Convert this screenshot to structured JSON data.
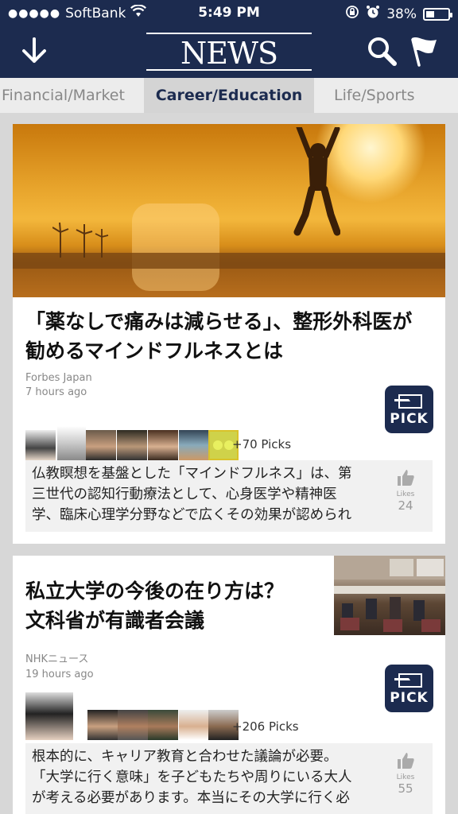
{
  "status": {
    "carrier": "SoftBank",
    "time": "5:49 PM",
    "battery": "38%"
  },
  "header": {
    "logo": "NEWS PICKS",
    "icons": [
      "download-arrow-icon",
      "search-icon",
      "flag-icon"
    ]
  },
  "tabs": [
    {
      "label": "Financial/Market",
      "active": false
    },
    {
      "label": "Career/Education",
      "active": true
    },
    {
      "label": "Life/Sports",
      "active": false
    }
  ],
  "articles": [
    {
      "title_line1": "「薬なしで痛みは減らせる」、整形外科医が",
      "title_line2": "勧めるマインドフルネスとは",
      "source": "Forbes Japan",
      "time": "7 hours ago",
      "pick_label": "PICK",
      "picks": "+70 Picks",
      "comment_line1": "仏教瞑想を基盤とした「マインドフルネス」は、第",
      "comment_line2": "三世代の認知行動療法として、心身医学や精神医",
      "comment_line3": "学、臨床心理学分野などで広くその効果が認められ",
      "likes_label": "Likes",
      "likes": "24"
    },
    {
      "title_line1": "私立大学の今後の在り方は？",
      "title_line2": "文科省が有識者会議",
      "source": "NHKニュース",
      "time": "19 hours ago",
      "pick_label": "PICK",
      "picks": "+206 Picks",
      "comment_line1": "根本的に、キャリア教育と合わせた議論が必要。",
      "comment_line2": "「大学に行く意味」を子どもたちや周りにいる大人",
      "comment_line3": "が考える必要があります。本当にその大学に行く必",
      "likes_label": "Likes",
      "likes": "55"
    }
  ],
  "colors": {
    "navy": "#1c2b4f",
    "tab_bg": "#ececec",
    "tab_active_bg": "#d4d4d4",
    "page_bg": "#d7d7d7"
  }
}
